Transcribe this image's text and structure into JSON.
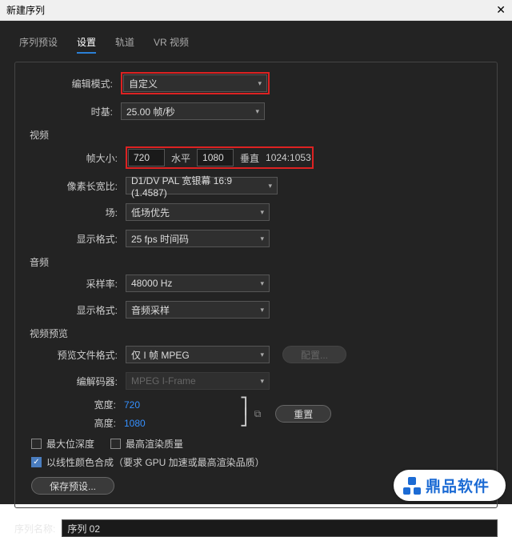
{
  "titlebar": {
    "title": "新建序列"
  },
  "tabs": {
    "preset": "序列预设",
    "settings": "设置",
    "tracks": "轨道",
    "vr": "VR 视频"
  },
  "edit_mode": {
    "label": "编辑模式:",
    "value": "自定义"
  },
  "timebase": {
    "label": "时基:",
    "value": "25.00 帧/秒"
  },
  "video": {
    "section": "视频",
    "frame_size_label": "帧大小:",
    "width": "720",
    "h_label": "水平",
    "height": "1080",
    "v_label": "垂直",
    "aspect": "1024:1053",
    "par_label": "像素长宽比:",
    "par_value": "D1/DV PAL 宽银幕 16:9 (1.4587)",
    "fields_label": "场:",
    "fields_value": "低场优先",
    "display_label": "显示格式:",
    "display_value": "25 fps 时间码"
  },
  "audio": {
    "section": "音频",
    "rate_label": "采样率:",
    "rate_value": "48000 Hz",
    "display_label": "显示格式:",
    "display_value": "音频采样"
  },
  "preview": {
    "section": "视频预览",
    "file_label": "预览文件格式:",
    "file_value": "仅 I 帧 MPEG",
    "codec_label": "编解码器:",
    "codec_value": "MPEG I-Frame",
    "config_btn": "配置...",
    "width_label": "宽度:",
    "width_value": "720",
    "height_label": "高度:",
    "height_value": "1080",
    "reset_btn": "重置"
  },
  "checks": {
    "max_depth": "最大位深度",
    "max_quality": "最高渲染质量",
    "linear": "以线性颜色合成（要求 GPU 加速或最高渲染品质）"
  },
  "save_preset": "保存预设...",
  "seq_name": {
    "label": "序列名称:",
    "value": "序列 02"
  },
  "brand": "鼎品软件"
}
